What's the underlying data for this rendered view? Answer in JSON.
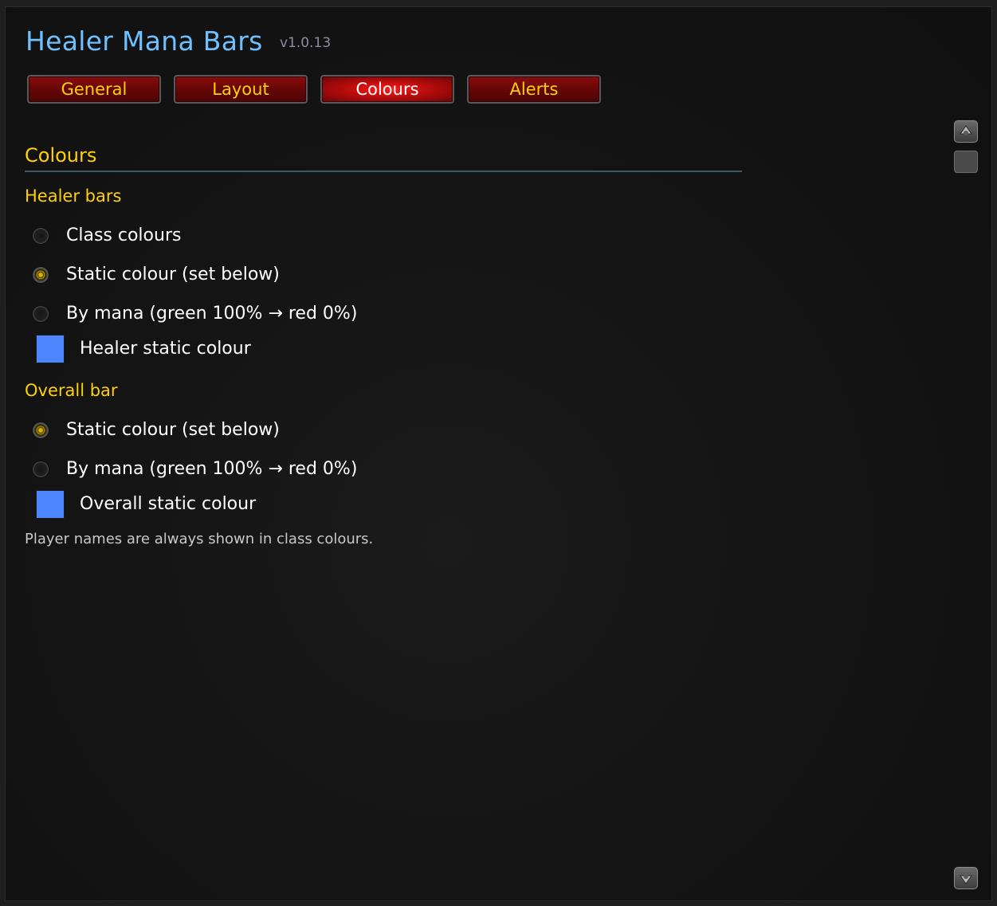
{
  "window": {
    "title": "Healer Mana Bars",
    "version": "v1.0.13"
  },
  "tabs": [
    {
      "label": "General",
      "active": false
    },
    {
      "label": "Layout",
      "active": false
    },
    {
      "label": "Colours",
      "active": true
    },
    {
      "label": "Alerts",
      "active": false
    }
  ],
  "section": {
    "title": "Colours"
  },
  "healer_bars": {
    "heading": "Healer bars",
    "options": [
      {
        "label": "Class colours",
        "checked": false
      },
      {
        "label": "Static colour (set below)",
        "checked": true
      },
      {
        "label": "By mana (green 100% → red 0%)",
        "checked": false
      }
    ],
    "swatch": {
      "label": "Healer static colour",
      "color": "#4d86ff"
    }
  },
  "overall_bar": {
    "heading": "Overall bar",
    "options": [
      {
        "label": "Static colour (set below)",
        "checked": true
      },
      {
        "label": "By mana (green 100% → red 0%)",
        "checked": false
      }
    ],
    "swatch": {
      "label": "Overall static colour",
      "color": "#4d86ff"
    }
  },
  "note": "Player names are always shown in class colours.",
  "colors": {
    "title": "#6fc0ff",
    "heading_gold": "#ffd100",
    "tab_red": "#8a0c0c",
    "swatch_blue": "#4d86ff"
  },
  "scrollbar": {
    "up_icon": "scroll-up-icon",
    "down_icon": "scroll-down-icon"
  }
}
